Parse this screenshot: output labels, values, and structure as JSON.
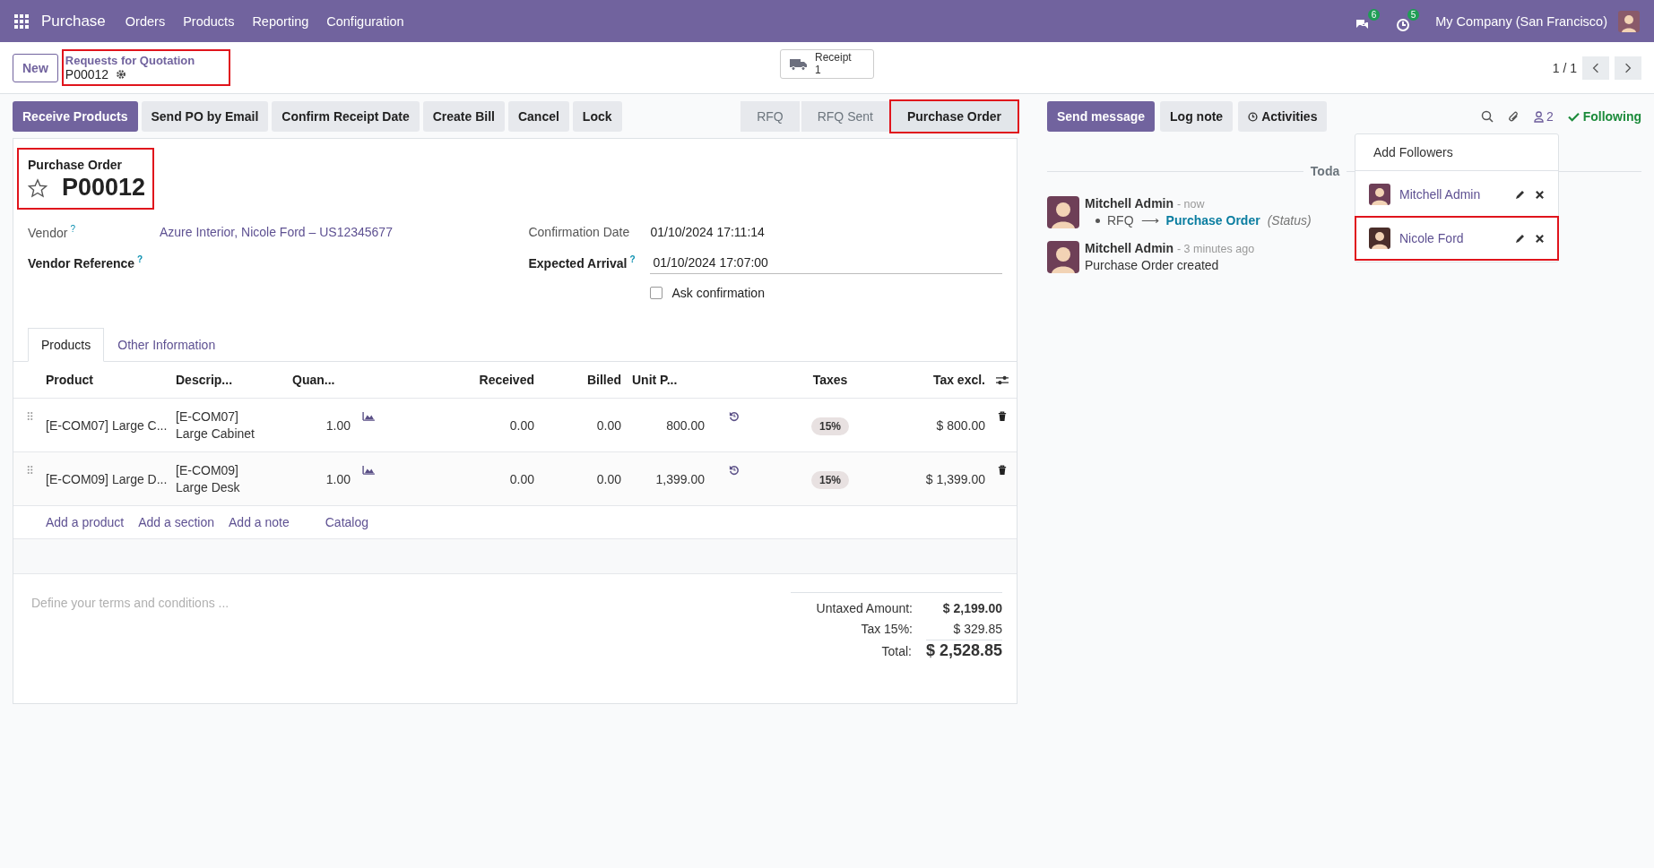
{
  "navbar": {
    "app_name": "Purchase",
    "menu": [
      "Orders",
      "Products",
      "Reporting",
      "Configuration"
    ],
    "messages_badge": "6",
    "activities_badge": "5",
    "company": "My Company (San Francisco)"
  },
  "control_panel": {
    "new_button": "New",
    "breadcrumb": {
      "parent": "Requests for Quotation",
      "current": "P00012",
      "highlighted": true
    },
    "smart_button": {
      "label": "Receipt",
      "count": "1"
    },
    "pager": "1 / 1"
  },
  "actions": [
    {
      "label": "Receive Products",
      "primary": true
    },
    {
      "label": "Send PO by Email",
      "primary": false
    },
    {
      "label": "Confirm Receipt Date",
      "primary": false
    },
    {
      "label": "Create Bill",
      "primary": false
    },
    {
      "label": "Cancel",
      "primary": false
    },
    {
      "label": "Lock",
      "primary": false
    }
  ],
  "status_steps": [
    {
      "label": "RFQ",
      "selected": false,
      "highlighted": false
    },
    {
      "label": "RFQ Sent",
      "selected": false,
      "highlighted": false
    },
    {
      "label": "Purchase Order",
      "selected": true,
      "highlighted": true
    }
  ],
  "form": {
    "title_label": "Purchase Order",
    "title": "P00012",
    "starred": false,
    "highlighted": true,
    "left_fields": [
      {
        "label": "Vendor",
        "help": "?",
        "value": "Azure Interior, Nicole Ford – US12345677",
        "emphasized": false
      },
      {
        "label": "Vendor Reference",
        "help": "?",
        "emphasized": true
      }
    ],
    "confirmation_date": {
      "label": "Confirmation Date",
      "value": "01/10/2024 17:11:14"
    },
    "expected_arrival": {
      "label": "Expected Arrival",
      "help": "?",
      "value": "01/10/2024 17:07:00"
    },
    "ask_confirmation": {
      "label": "Ask confirmation",
      "checked": false
    },
    "tabs": [
      {
        "label": "Products",
        "selected": true
      },
      {
        "label": "Other Information",
        "selected": false
      }
    ],
    "table": {
      "columns": [
        "Product",
        "Descrip...",
        "Quan...",
        "Received",
        "Billed",
        "Unit P...",
        "Taxes",
        "Tax excl."
      ],
      "rows": [
        {
          "product": "[E-COM07] Large C...",
          "description": [
            "[E-COM07]",
            "Large Cabinet"
          ],
          "quantity": "1.00",
          "received": "0.00",
          "billed": "0.00",
          "unit_price": "800.00",
          "tax": "15%",
          "subtotal": "$ 800.00"
        },
        {
          "product": "[E-COM09] Large D...",
          "description": [
            "[E-COM09]",
            "Large Desk"
          ],
          "quantity": "1.00",
          "received": "0.00",
          "billed": "0.00",
          "unit_price": "1,399.00",
          "tax": "15%",
          "subtotal": "$ 1,399.00"
        }
      ],
      "add_links": [
        "Add a product",
        "Add a section",
        "Add a note",
        "Catalog"
      ]
    },
    "terms": {
      "placeholder": "Define your terms and conditions ..."
    },
    "totals": [
      {
        "label": "Untaxed Amount:",
        "value": "$ 2,199.00",
        "kind": "bold"
      },
      {
        "label": "Tax 15%:",
        "value": "$ 329.85",
        "kind": "plain"
      },
      {
        "label": "Total:",
        "value": "$ 2,528.85",
        "kind": "grand"
      }
    ]
  },
  "chatter": {
    "buttons": [
      {
        "label": "Send message",
        "primary": true
      },
      {
        "label": "Log note",
        "primary": false
      },
      {
        "label": "Activities",
        "primary": false
      }
    ],
    "followers_count": "2",
    "following": "Following",
    "date_separator": "Toda",
    "messages": [
      {
        "author": "Mitchell Admin",
        "time": "- now",
        "kind": "tracking",
        "old": "RFQ",
        "arrow": "⟶",
        "new": "Purchase Order",
        "field": "(Status)"
      },
      {
        "author": "Mitchell Admin",
        "time": "- 3 minutes ago",
        "kind": "text",
        "body": "Purchase Order created"
      }
    ]
  },
  "followers_menu": {
    "add": "Add Followers",
    "followers": [
      {
        "name": "Mitchell Admin",
        "highlighted": false
      },
      {
        "name": "Nicole Ford",
        "highlighted": true
      }
    ]
  }
}
